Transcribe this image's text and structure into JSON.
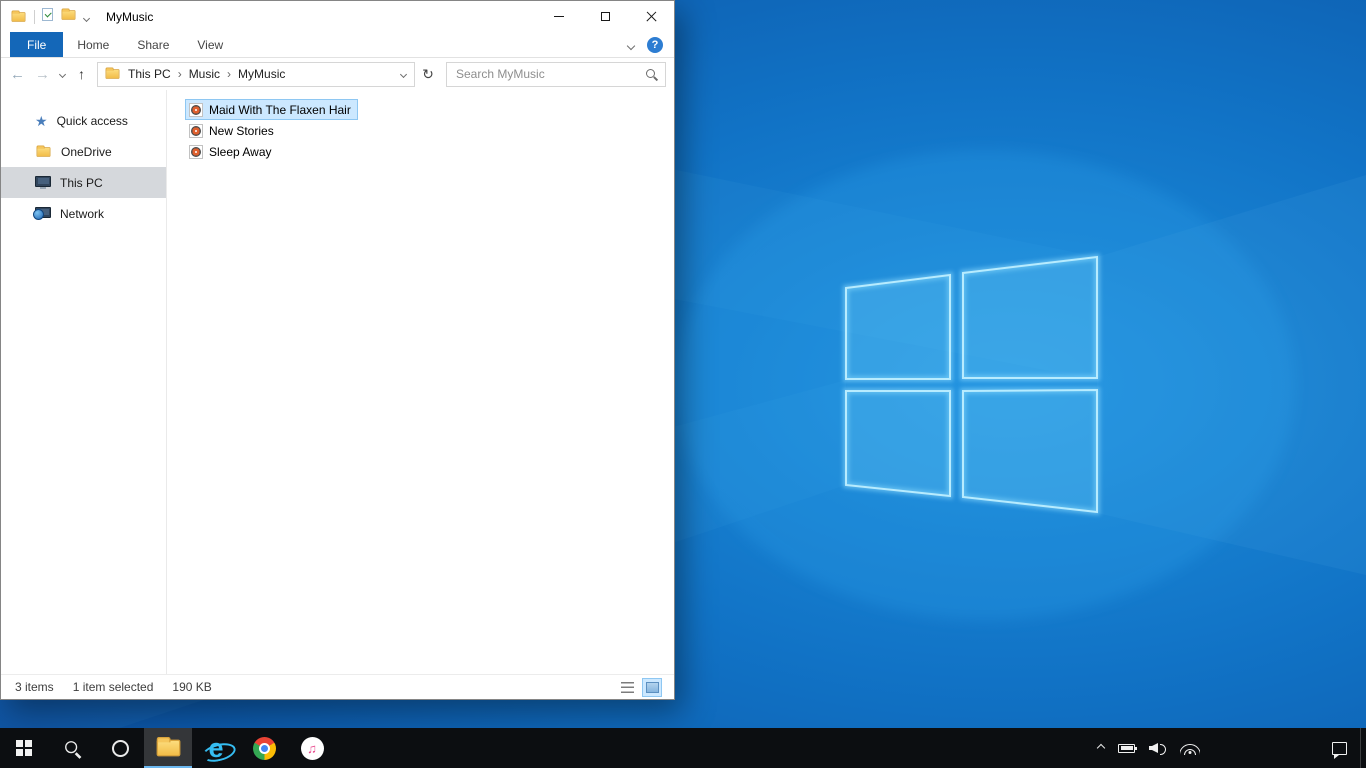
{
  "glyphs": {
    "back_arrow": "←",
    "forward_arrow": "→",
    "up_arrow": "↑",
    "refresh": "↻",
    "help": "?",
    "crumb_separator": "›",
    "quick_access_star": "★",
    "ie_letter": "e",
    "music_note": "♫"
  },
  "colors": {
    "file_tab_blue": "#1467b8",
    "selection_bg": "#cce8ff",
    "selection_border": "#8ec7f2",
    "nav_selected_bg": "#d5d8dc",
    "taskbar_bg": "#0c0e11",
    "desktop_base": "#0a4fa0"
  },
  "explorer": {
    "title": "MyMusic",
    "ribbon": {
      "file_tab": "File",
      "tabs": [
        {
          "label": "Home"
        },
        {
          "label": "Share"
        },
        {
          "label": "View"
        }
      ]
    },
    "address_bar": {
      "crumbs": [
        {
          "label": "This PC"
        },
        {
          "label": "Music"
        },
        {
          "label": "MyMusic"
        }
      ],
      "search_placeholder": "Search MyMusic"
    },
    "sidebar": {
      "items": [
        {
          "label": "Quick access",
          "icon": "star-icon",
          "selected": false
        },
        {
          "label": "OneDrive",
          "icon": "folder-icon",
          "selected": false
        },
        {
          "label": "This PC",
          "icon": "computer-icon",
          "selected": true
        },
        {
          "label": "Network",
          "icon": "network-icon",
          "selected": false
        }
      ]
    },
    "files": {
      "items": [
        {
          "name": "Maid With The Flaxen Hair",
          "icon": "audio-file-icon",
          "selected": true
        },
        {
          "name": "New Stories",
          "icon": "audio-file-icon",
          "selected": false
        },
        {
          "name": "Sleep Away",
          "icon": "audio-file-icon",
          "selected": false
        }
      ]
    },
    "status_bar": {
      "items_count": "3 items",
      "selection_count": "1 item selected",
      "selection_size": "190 KB"
    }
  },
  "taskbar": {
    "buttons": [
      {
        "name": "start",
        "icon": "windows-logo-icon",
        "active": false
      },
      {
        "name": "search",
        "icon": "search-icon",
        "active": false
      },
      {
        "name": "cortana",
        "icon": "cortana-ring-icon",
        "active": false
      },
      {
        "name": "file-explorer",
        "icon": "folder-icon",
        "active": true
      },
      {
        "name": "internet-explorer",
        "icon": "ie-icon",
        "active": false
      },
      {
        "name": "chrome",
        "icon": "chrome-icon",
        "active": false
      },
      {
        "name": "itunes",
        "icon": "itunes-icon",
        "active": false
      }
    ],
    "tray": [
      "hidden-icons-chevron",
      "battery-icon",
      "volume-icon",
      "wifi-icon",
      "action-center-icon",
      "show-desktop"
    ]
  }
}
